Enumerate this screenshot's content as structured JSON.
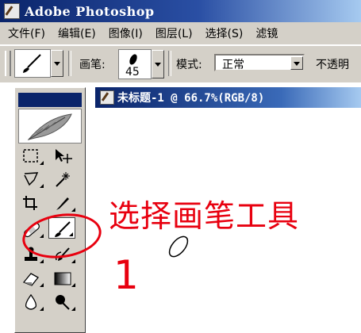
{
  "window": {
    "title": "Adobe Photoshop",
    "icon": "photoshop-app-icon"
  },
  "menubar": {
    "items": [
      "文件(F)",
      "编辑(E)",
      "图像(I)",
      "图层(L)",
      "选择(S)",
      "滤镜"
    ]
  },
  "options": {
    "brush_label": "画笔:",
    "brush_size": "45",
    "mode_label": "模式:",
    "mode_value": "正常",
    "opacity_label": "不透明"
  },
  "document": {
    "title": "未标题-1 @ 66.7%(RGB/8)"
  },
  "annotation": {
    "text": "选择画笔工具",
    "step_number": "1",
    "color": "#e8000f"
  },
  "toolbox": {
    "tools": [
      "rectangular-marquee-icon",
      "move-icon",
      "lasso-icon",
      "magic-wand-icon",
      "crop-icon",
      "slice-icon",
      "healing-brush-icon",
      "brush-icon",
      "clone-stamp-icon",
      "history-brush-icon",
      "eraser-icon",
      "gradient-icon",
      "blur-icon",
      "dodge-icon"
    ],
    "active_tool": "brush-icon"
  }
}
